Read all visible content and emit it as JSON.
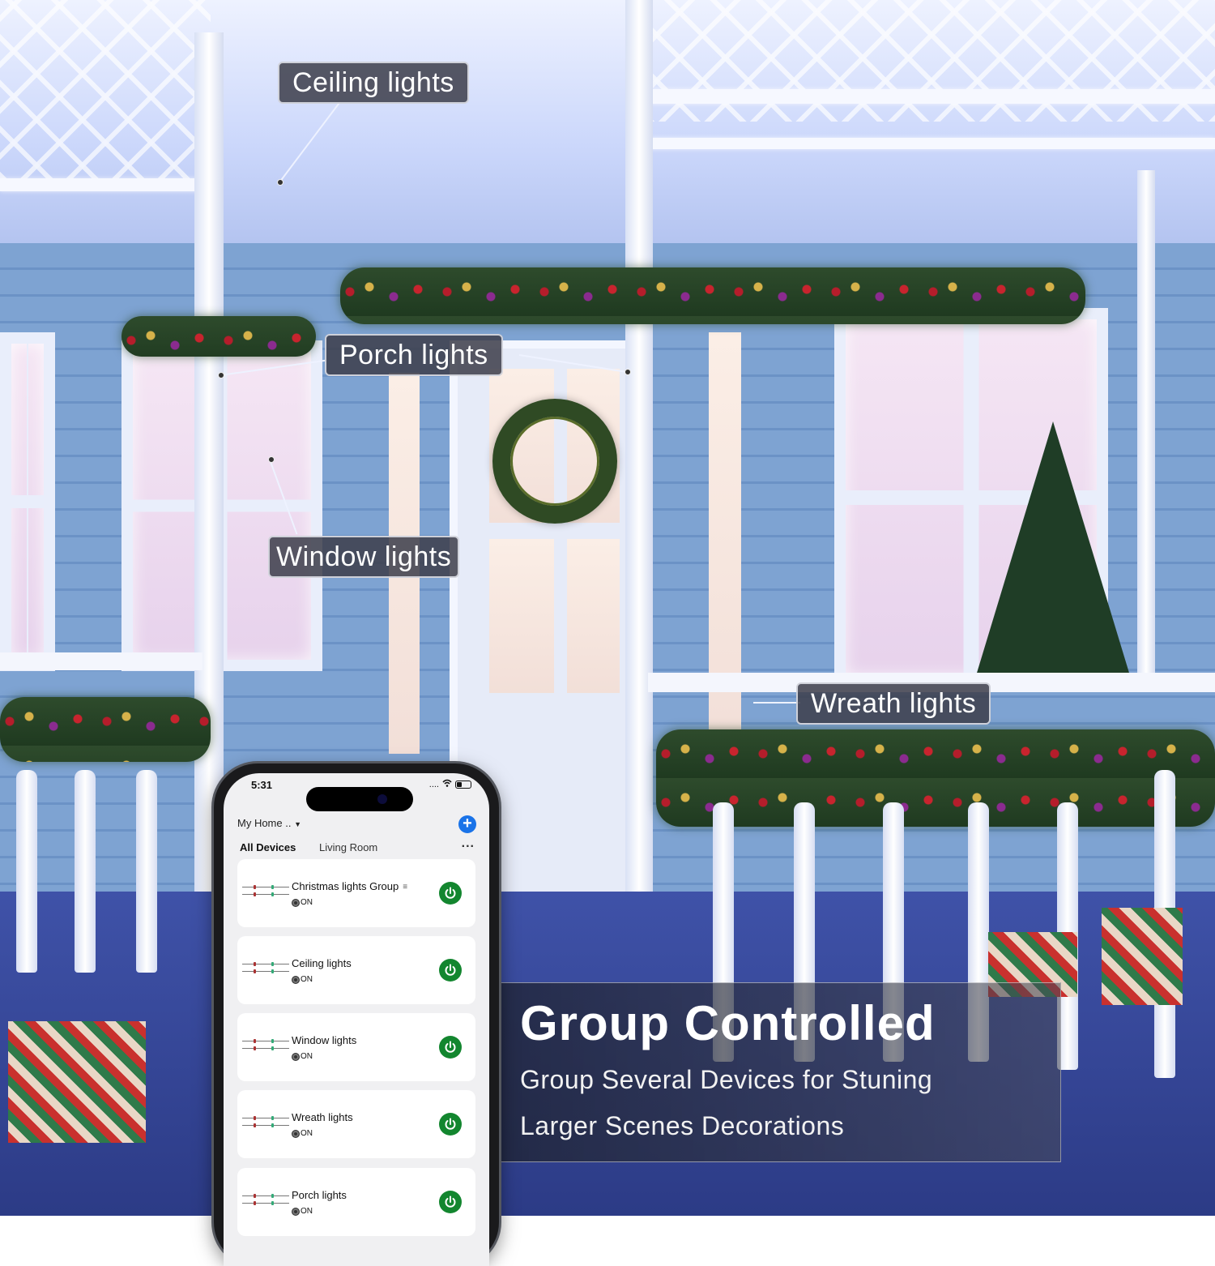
{
  "callouts": {
    "ceiling": "Ceiling lights",
    "porch": "Porch lights",
    "window": "Window lights",
    "wreath": "Wreath lights"
  },
  "headline": {
    "title": "Group Controlled",
    "line1": "Group Several Devices for Stuning",
    "line2": "Larger Scenes Decorations"
  },
  "phone": {
    "status_time": "5:31",
    "signal_text": "....",
    "home_title": "My Home ..",
    "add_icon": "+",
    "tabs": [
      {
        "label": "All Devices",
        "active": true
      },
      {
        "label": "Living Room",
        "active": false
      }
    ],
    "more_icon": "...",
    "devices": [
      {
        "name": "Christmas lights Group",
        "status": "ON",
        "is_group": true,
        "group_icon": "≡"
      },
      {
        "name": "Ceiling lights",
        "status": "ON"
      },
      {
        "name": "Window lights",
        "status": "ON"
      },
      {
        "name": "Wreath lights",
        "status": "ON"
      },
      {
        "name": "Porch lights",
        "status": "ON"
      }
    ],
    "colors": {
      "accent": "#1a73e8",
      "power_on": "#13862f"
    }
  }
}
